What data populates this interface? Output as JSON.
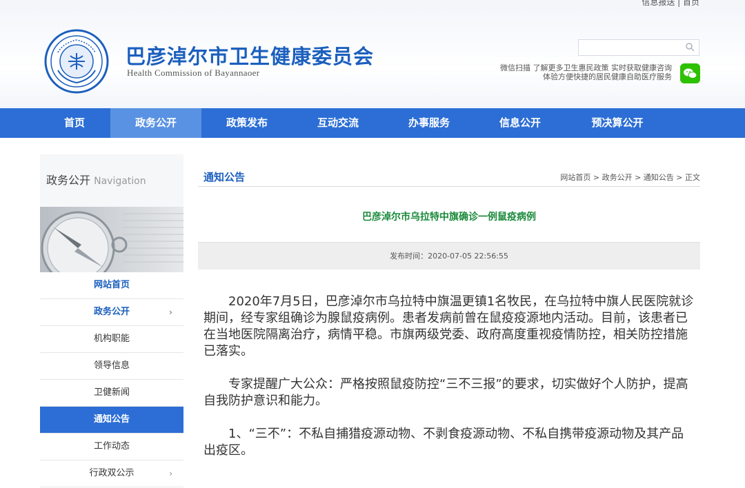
{
  "top": {
    "links": "信息报送 | 首页"
  },
  "header": {
    "title_cn": "巴彦淖尔市卫生健康委员会",
    "title_en": "Health Commission of Bayannaoer",
    "search_placeholder": "",
    "wechat_line1": "微信扫描 了解更多卫生惠民政策 实时获取健康咨询",
    "wechat_line2": "体验方便快捷的居民健康自助医疗服务"
  },
  "nav": {
    "items": [
      "首页",
      "政务公开",
      "政策发布",
      "互动交流",
      "办事服务",
      "信息公开",
      "预决算公开"
    ],
    "active_index": 1
  },
  "sidebar": {
    "title": "政务公开",
    "title_en": "Navigation",
    "items": [
      {
        "label": "网站首页"
      },
      {
        "label": "政务公开",
        "arrow": "›"
      },
      {
        "label": "机构职能"
      },
      {
        "label": "领导信息"
      },
      {
        "label": "卫健新闻"
      },
      {
        "label": "通知公告"
      },
      {
        "label": "工作动态"
      },
      {
        "label": "行政双公示",
        "arrow": "›"
      }
    ]
  },
  "main": {
    "section_title": "通知公告",
    "breadcrumb": "网站首页 > 政务公开 > 通知公告 > 正文",
    "article_title": "巴彦淖尔市乌拉特中旗确诊一例鼠疫病例",
    "publish": "发布时间：2020-07-05 22:56:55",
    "paragraphs": [
      "2020年7月5日，巴彦淖尔市乌拉特中旗温更镇1名牧民，在乌拉特中旗人民医院就诊期间，经专家组确诊为腺鼠疫病例。患者发病前曾在鼠疫疫源地内活动。目前，该患者已在当地医院隔离治疗，病情平稳。市旗两级党委、政府高度重视疫情防控，相关防控措施已落实。",
      "专家提醒广大公众：严格按照鼠疫防控“三不三报”的要求，切实做好个人防护，提高自我防护意识和能力。",
      "1、“三不”：不私自捕猎疫源动物、不剥食疫源动物、不私自携带疫源动物及其产品出疫区。"
    ]
  },
  "colors": {
    "brand_blue": "#2c6ed5",
    "title_green": "#1a8a3a",
    "nav_active": "#5a92e3"
  }
}
